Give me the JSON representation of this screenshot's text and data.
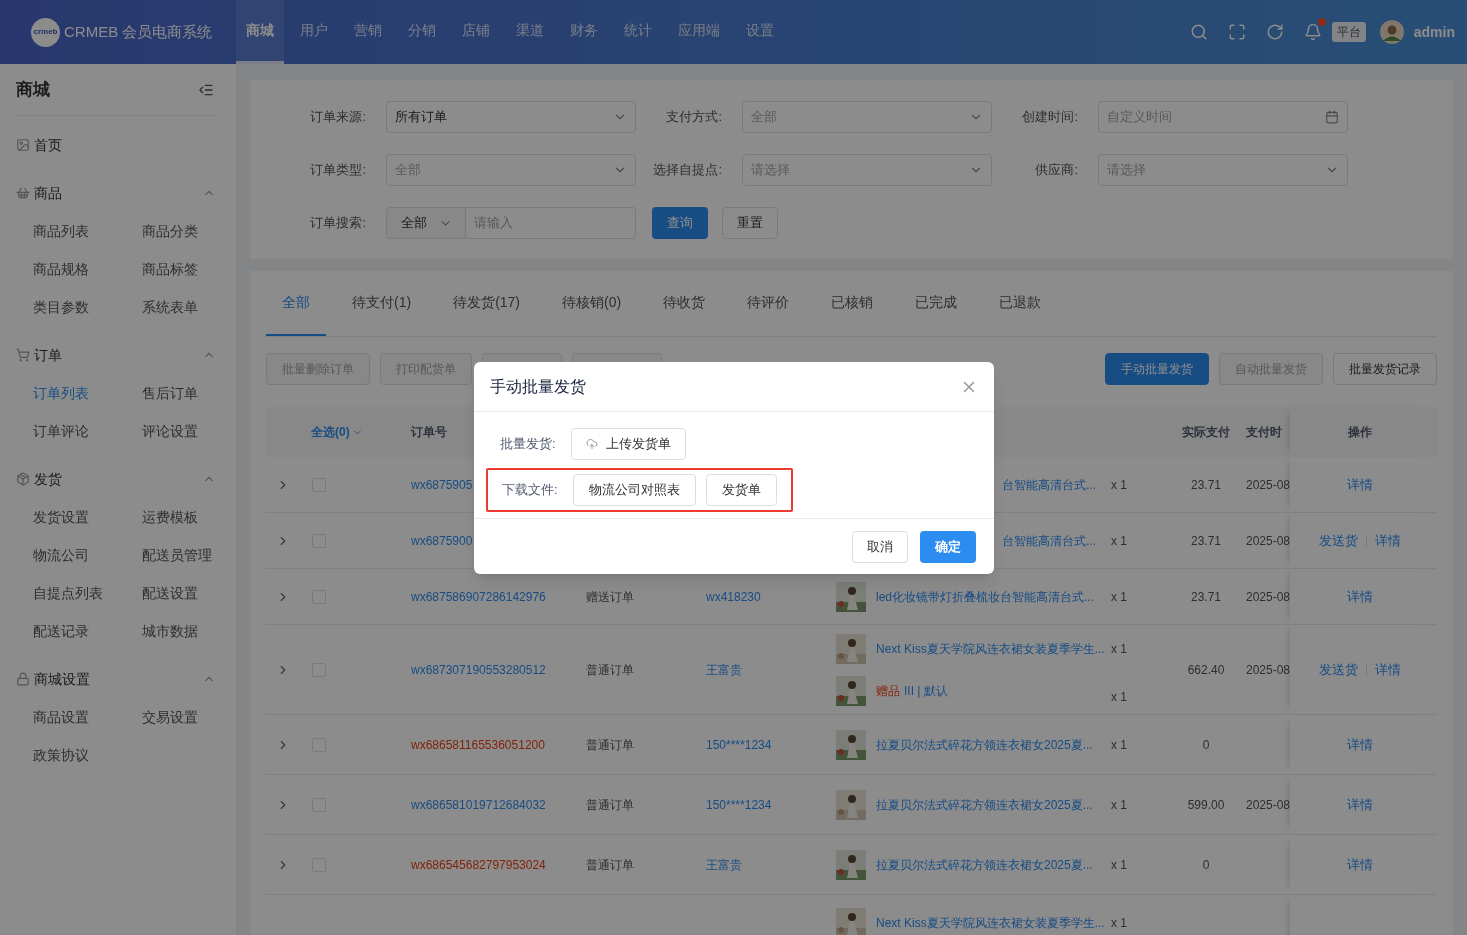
{
  "header": {
    "logo_mark": "crmeb",
    "brand": "CRMEB 会员电商系统",
    "nav": [
      {
        "label": "商城",
        "selected": true
      },
      {
        "label": "用户",
        "selected": false
      },
      {
        "label": "营销",
        "selected": false
      },
      {
        "label": "分销",
        "selected": false
      },
      {
        "label": "店铺",
        "selected": false
      },
      {
        "label": "渠道",
        "selected": false
      },
      {
        "label": "财务",
        "selected": false
      },
      {
        "label": "统计",
        "selected": false
      },
      {
        "label": "应用端",
        "selected": false
      },
      {
        "label": "设置",
        "selected": false
      }
    ],
    "notification_dot": true,
    "platform_badge": "平台",
    "user": "admin"
  },
  "sidebar": {
    "title": "商城",
    "items": [
      {
        "kind": "link",
        "label": "首页"
      },
      {
        "kind": "group",
        "label": "商品",
        "expanded": true,
        "children": [
          {
            "label": "商品列表",
            "selected": false
          },
          {
            "label": "商品分类",
            "selected": false
          },
          {
            "label": "商品规格",
            "selected": false
          },
          {
            "label": "商品标签",
            "selected": false
          },
          {
            "label": "类目参数",
            "selected": false
          },
          {
            "label": "系统表单",
            "selected": false
          }
        ]
      },
      {
        "kind": "group",
        "label": "订单",
        "expanded": true,
        "children": [
          {
            "label": "订单列表",
            "selected": true
          },
          {
            "label": "售后订单",
            "selected": false
          },
          {
            "label": "订单评论",
            "selected": false
          },
          {
            "label": "评论设置",
            "selected": false
          }
        ]
      },
      {
        "kind": "group",
        "label": "发货",
        "expanded": true,
        "children": [
          {
            "label": "发货设置",
            "selected": false
          },
          {
            "label": "运费模板",
            "selected": false
          },
          {
            "label": "物流公司",
            "selected": false
          },
          {
            "label": "配送员管理",
            "selected": false
          },
          {
            "label": "自提点列表",
            "selected": false
          },
          {
            "label": "配送设置",
            "selected": false
          },
          {
            "label": "配送记录",
            "selected": false
          },
          {
            "label": "城市数据",
            "selected": false
          }
        ]
      },
      {
        "kind": "group",
        "label": "商城设置",
        "expanded": true,
        "children": [
          {
            "label": "商品设置",
            "selected": false
          },
          {
            "label": "交易设置",
            "selected": false
          },
          {
            "label": "政策协议",
            "selected": false
          }
        ]
      }
    ]
  },
  "filters": {
    "rows": [
      [
        {
          "label": "订单来源:",
          "kind": "select",
          "value": "所有订单"
        },
        {
          "label": "支付方式:",
          "kind": "select",
          "placeholder": "全部"
        },
        {
          "label": "创建时间:",
          "kind": "date",
          "placeholder": "自定义时间"
        }
      ],
      [
        {
          "label": "订单类型:",
          "kind": "select",
          "placeholder": "全部"
        },
        {
          "label": "选择自提点:",
          "kind": "select",
          "placeholder": "请选择"
        },
        {
          "label": "供应商:",
          "kind": "select",
          "placeholder": "请选择"
        }
      ]
    ],
    "search": {
      "label": "订单搜索:",
      "scope": "全部",
      "placeholder": "请输入"
    },
    "query_button": "查询",
    "reset_button": "重置"
  },
  "tabs": [
    {
      "label": "全部",
      "selected": true
    },
    {
      "label": "待支付(1)",
      "selected": false
    },
    {
      "label": "待发货(17)",
      "selected": false
    },
    {
      "label": "待核销(0)",
      "selected": false
    },
    {
      "label": "待收货",
      "selected": false
    },
    {
      "label": "待评价",
      "selected": false
    },
    {
      "label": "已核销",
      "selected": false
    },
    {
      "label": "已完成",
      "selected": false
    },
    {
      "label": "已退款",
      "selected": false
    }
  ],
  "toolbar_left": [
    {
      "label": "批量删除订单",
      "disabled": true
    },
    {
      "label": "打印配货单",
      "disabled": true
    }
  ],
  "toolbar_right": [
    {
      "label": "手动批量发货",
      "kind": "primary"
    },
    {
      "label": "自动批量发货",
      "kind": "disabled"
    },
    {
      "label": "批量发货记录",
      "kind": "plain"
    }
  ],
  "table": {
    "select_all": "全选(0)",
    "columns": [
      "订单号",
      "实际支付",
      "支付时",
      "操作"
    ],
    "rows": [
      {
        "order_no": "wx6875905",
        "kind": "normal",
        "checked": false,
        "products": [
          {
            "name": "台智能高清台式...",
            "qty": "x 1",
            "thumb": false
          }
        ],
        "paid": "23.71",
        "time": "2025-08",
        "actions": [
          "详情"
        ]
      },
      {
        "order_no": "wx6875900",
        "kind": "normal",
        "checked": false,
        "products": [
          {
            "name": "台智能高清台式...",
            "qty": "x 1",
            "thumb": false
          }
        ],
        "paid": "23.71",
        "time": "2025-08",
        "actions": [
          "发送货",
          "详情"
        ]
      },
      {
        "order_no": "wx687586907286142976",
        "kind": "normal",
        "checked": false,
        "type": "赠送订单",
        "user": "wx418230",
        "products": [
          {
            "name": "led化妆镜带灯折叠梳妆台智能高清台式...",
            "qty": "x 1",
            "thumb": true
          }
        ],
        "paid": "23.71",
        "time": "2025-08",
        "actions": [
          "详情"
        ]
      },
      {
        "order_no": "wx687307190553280512",
        "kind": "normal",
        "checked": false,
        "type": "普通订单",
        "user": "王富贵",
        "products": [
          {
            "name": "Next Kiss夏天学院风连衣裙女装夏季学生...",
            "qty": "x 1",
            "thumb": true
          },
          {
            "tag": "赠品",
            "name": "III | 默认",
            "qty": "x 1",
            "thumb": true
          }
        ],
        "paid": "662.40",
        "time": "2025-08",
        "actions": [
          "发送货",
          "详情"
        ]
      },
      {
        "order_no": "wx686581165536051200",
        "kind": "alert",
        "checked": false,
        "type": "普通订单",
        "user": "150****1234",
        "products": [
          {
            "name": "拉夏贝尔法式碎花方领连衣裙女2025夏...",
            "qty": "x 1",
            "thumb": true
          }
        ],
        "paid": "0",
        "actions": [
          "详情"
        ]
      },
      {
        "order_no": "wx686581019712684032",
        "kind": "normal",
        "checked": false,
        "type": "普通订单",
        "user": "150****1234",
        "products": [
          {
            "name": "拉夏贝尔法式碎花方领连衣裙女2025夏...",
            "qty": "x 1",
            "thumb": true
          }
        ],
        "paid": "599.00",
        "time": "2025-08",
        "actions": [
          "详情"
        ]
      },
      {
        "order_no": "wx686545682797953024",
        "kind": "alert",
        "checked": false,
        "type": "普通订单",
        "user": "王富贵",
        "products": [
          {
            "name": "拉夏贝尔法式碎花方领连衣裙女2025夏...",
            "qty": "x 1",
            "thumb": true
          }
        ],
        "paid": "0",
        "actions": [
          "详情"
        ]
      },
      {
        "products": [
          {
            "name": "Next Kiss夏天学院风连衣裙女装夏季学生...",
            "qty": "x 1",
            "thumb": true
          }
        ],
        "actions": []
      }
    ]
  },
  "dialog": {
    "title": "手动批量发货",
    "upload_label": "批量发货:",
    "upload_button": "上传发货单",
    "download_label": "下载文件:",
    "download_buttons": [
      "物流公司对照表",
      "发货单"
    ],
    "highlighted": true,
    "cancel": "取消",
    "confirm": "确定"
  }
}
